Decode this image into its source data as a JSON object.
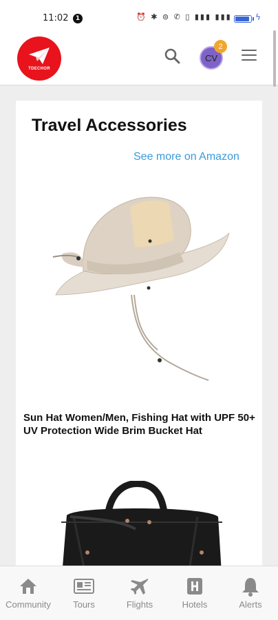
{
  "status_bar": {
    "time": "11:02",
    "notification_count": "1",
    "icons": "⏰ ✱ ⊜ ✆ ▯ ▮▮▮ ▮▮▮"
  },
  "header": {
    "logo_text": "TDECHOR",
    "avatar_initials": "CV",
    "avatar_badge": "2"
  },
  "card": {
    "title": "Travel Accessories",
    "see_more_label": "See more on Amazon",
    "products": [
      {
        "title": "Sun Hat Women/Men, Fishing Hat with UPF 50+ UV Protection Wide Brim Bucket Hat",
        "image_icon": "bucket-hat-image"
      },
      {
        "image_icon": "duffel-bag-image"
      }
    ]
  },
  "bottom_nav": {
    "items": [
      {
        "label": "Community",
        "icon": "home-icon"
      },
      {
        "label": "Tours",
        "icon": "tours-icon"
      },
      {
        "label": "Flights",
        "icon": "airplane-icon"
      },
      {
        "label": "Hotels",
        "icon": "hotel-icon"
      },
      {
        "label": "Alerts",
        "icon": "bell-icon"
      }
    ]
  },
  "colors": {
    "brand_red": "#e8131c",
    "link_blue": "#3a9ad9",
    "avatar_purple": "#7e63c7",
    "badge_orange": "#f3a52c",
    "nav_gray": "#8a8a8a"
  }
}
